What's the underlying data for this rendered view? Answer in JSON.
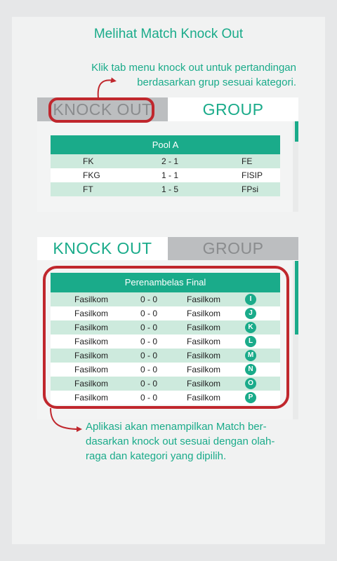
{
  "title": "Melihat Match Knock Out",
  "note_top": [
    "Klik tab menu knock out untuk pertandingan",
    "berdasarkan grup sesuai kategori."
  ],
  "note_bottom": [
    "Aplikasi akan menampilkan Match ber-",
    "dasarkan knock out sesuai dengan olah-",
    "raga dan kategori yang dipilih."
  ],
  "screen1": {
    "tabs": [
      {
        "label": "KNOCK OUT",
        "selected": false
      },
      {
        "label": "GROUP",
        "selected": true
      }
    ],
    "table_title": "Pool A",
    "rows": [
      {
        "home": "FK",
        "score": "2 - 1",
        "away": "FE"
      },
      {
        "home": "FKG",
        "score": "1 - 1",
        "away": "FISIP"
      },
      {
        "home": "FT",
        "score": "1 - 5",
        "away": "FPsi"
      }
    ]
  },
  "screen2": {
    "tabs": [
      {
        "label": "KNOCK OUT",
        "selected": true
      },
      {
        "label": "GROUP",
        "selected": false
      }
    ],
    "table_title": "Perenambelas Final",
    "rows": [
      {
        "home": "Fasilkom",
        "score": "0 - 0",
        "away": "Fasilkom",
        "badge": "I"
      },
      {
        "home": "Fasilkom",
        "score": "0 - 0",
        "away": "Fasilkom",
        "badge": "J"
      },
      {
        "home": "Fasilkom",
        "score": "0 - 0",
        "away": "Fasilkom",
        "badge": "K"
      },
      {
        "home": "Fasilkom",
        "score": "0 - 0",
        "away": "Fasilkom",
        "badge": "L"
      },
      {
        "home": "Fasilkom",
        "score": "0 - 0",
        "away": "Fasilkom",
        "badge": "M"
      },
      {
        "home": "Fasilkom",
        "score": "0 - 0",
        "away": "Fasilkom",
        "badge": "N"
      },
      {
        "home": "Fasilkom",
        "score": "0 - 0",
        "away": "Fasilkom",
        "badge": "O"
      },
      {
        "home": "Fasilkom",
        "score": "0 - 0",
        "away": "Fasilkom",
        "badge": "P"
      }
    ]
  },
  "colors": {
    "accent": "#1aab8a",
    "highlight": "#c0272d",
    "row_alt": "#cdeadd",
    "tab_inactive": "#bcbec0"
  }
}
